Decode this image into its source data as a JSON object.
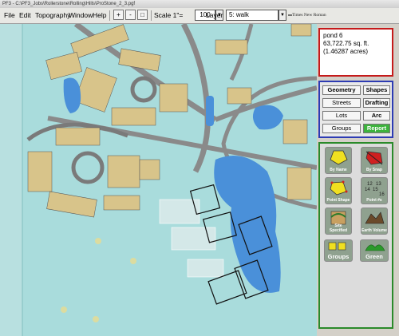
{
  "window": {
    "title": "PF3 - C:\\PF3_Jobs\\Rollerstone\\Rolling\\Hills\\ProStone_2_3.pgf"
  },
  "menu": [
    "File",
    "Edit",
    "Topography",
    "Window",
    "Help"
  ],
  "toolbar": {
    "zoom_in_glyph": "+",
    "zoom_out_glyph": "-",
    "zoom_fit_glyph": "□",
    "scale_label": "Scale 1\"=",
    "scale_value": "100",
    "layer_label": "Layer",
    "layer_value": "5: walk",
    "font_value": "Times New Roman",
    "dropdown_glyph": "▼"
  },
  "info_panel": {
    "line1": "pond 6",
    "line2": "63,722.75 sq. ft.",
    "line3": "(1.46287 acres)"
  },
  "panel_buttons": [
    {
      "label": "Geometry",
      "bold": true
    },
    {
      "label": "Shapes",
      "bold": true
    },
    {
      "label": "Streets",
      "bold": false
    },
    {
      "label": "Drafting",
      "bold": true
    },
    {
      "label": "Lots",
      "bold": false
    },
    {
      "label": "Arc",
      "bold": true
    },
    {
      "label": "Groups",
      "bold": false
    },
    {
      "label": "Report",
      "bold": true,
      "highlight": true
    }
  ],
  "tool_buttons": [
    {
      "label": "By Name",
      "icon": "yellow-pentagon-icon"
    },
    {
      "label": "By Snap",
      "icon": "red-polygon-snap-icon"
    },
    {
      "label": "Point Shape",
      "icon": "point-shape-icon"
    },
    {
      "label": "Point #s",
      "icon": "point-numbers-icon"
    },
    {
      "label": "Site Specified",
      "icon": "site-specified-icon"
    },
    {
      "label": "Earth Volume",
      "icon": "earth-volume-icon"
    },
    {
      "label": "Groups",
      "icon": "groups-icon"
    },
    {
      "label": "Green",
      "icon": "green-icon"
    }
  ],
  "point_numbers": [
    "12",
    "13",
    "14",
    "15",
    "16"
  ],
  "colors": {
    "water": "#4a90d9",
    "land": "#a9dcdc",
    "road": "#8a8a8a",
    "info_border": "#c51a1a",
    "button_border": "#2d3bb3",
    "tool_border": "#2a8a2a",
    "report_green": "#3db33d"
  }
}
